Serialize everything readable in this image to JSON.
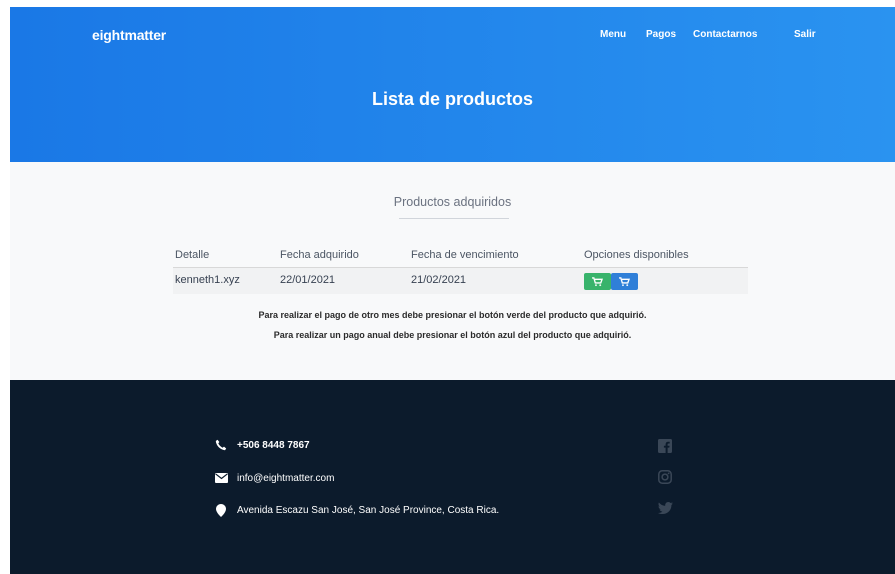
{
  "header": {
    "brand": "eightmatter",
    "nav": [
      "Menu",
      "Pagos",
      "Contactarnos",
      "Salir"
    ],
    "title": "Lista de productos"
  },
  "main": {
    "section_title": "Productos adquiridos",
    "table": {
      "columns": [
        "Detalle",
        "Fecha adquirido",
        "Fecha de vencimiento",
        "Opciones disponibles"
      ],
      "rows": [
        {
          "detalle": "kenneth1.xyz",
          "fecha_adquirido": "22/01/2021",
          "fecha_vencimiento": "21/02/2021"
        }
      ]
    },
    "notes": [
      "Para realizar el pago de otro mes debe presionar el botón verde del producto que adquirió.",
      "Para realizar un pago anual debe presionar el botón azul del producto que adquirió."
    ]
  },
  "footer": {
    "phone": "+506 8448 7867",
    "email": "info@eightmatter.com",
    "address": "Avenida Escazu San José, San José Province, Costa Rica.",
    "social_icons": [
      "facebook-icon",
      "instagram-icon",
      "twitter-icon"
    ]
  },
  "colors": {
    "hero_start": "#1a78e6",
    "hero_end": "#2a93f0",
    "green_button": "#38b36b",
    "blue_button": "#2f7fd8",
    "footer_bg": "#0c1b2c",
    "social_icon": "#3a4757"
  }
}
